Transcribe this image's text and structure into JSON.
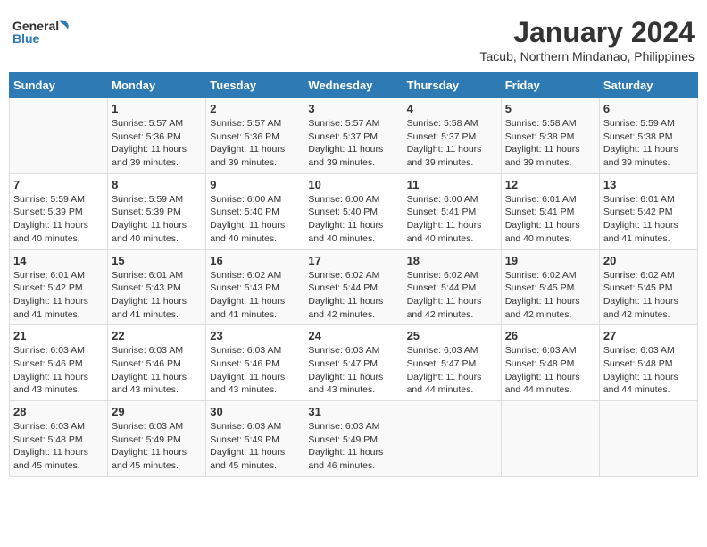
{
  "header": {
    "logo_line1": "General",
    "logo_line2": "Blue",
    "month_title": "January 2024",
    "location": "Tacub, Northern Mindanao, Philippines"
  },
  "days_of_week": [
    "Sunday",
    "Monday",
    "Tuesday",
    "Wednesday",
    "Thursday",
    "Friday",
    "Saturday"
  ],
  "weeks": [
    [
      {
        "day": "",
        "info": ""
      },
      {
        "day": "1",
        "info": "Sunrise: 5:57 AM\nSunset: 5:36 PM\nDaylight: 11 hours\nand 39 minutes."
      },
      {
        "day": "2",
        "info": "Sunrise: 5:57 AM\nSunset: 5:36 PM\nDaylight: 11 hours\nand 39 minutes."
      },
      {
        "day": "3",
        "info": "Sunrise: 5:57 AM\nSunset: 5:37 PM\nDaylight: 11 hours\nand 39 minutes."
      },
      {
        "day": "4",
        "info": "Sunrise: 5:58 AM\nSunset: 5:37 PM\nDaylight: 11 hours\nand 39 minutes."
      },
      {
        "day": "5",
        "info": "Sunrise: 5:58 AM\nSunset: 5:38 PM\nDaylight: 11 hours\nand 39 minutes."
      },
      {
        "day": "6",
        "info": "Sunrise: 5:59 AM\nSunset: 5:38 PM\nDaylight: 11 hours\nand 39 minutes."
      }
    ],
    [
      {
        "day": "7",
        "info": "Sunrise: 5:59 AM\nSunset: 5:39 PM\nDaylight: 11 hours\nand 40 minutes."
      },
      {
        "day": "8",
        "info": "Sunrise: 5:59 AM\nSunset: 5:39 PM\nDaylight: 11 hours\nand 40 minutes."
      },
      {
        "day": "9",
        "info": "Sunrise: 6:00 AM\nSunset: 5:40 PM\nDaylight: 11 hours\nand 40 minutes."
      },
      {
        "day": "10",
        "info": "Sunrise: 6:00 AM\nSunset: 5:40 PM\nDaylight: 11 hours\nand 40 minutes."
      },
      {
        "day": "11",
        "info": "Sunrise: 6:00 AM\nSunset: 5:41 PM\nDaylight: 11 hours\nand 40 minutes."
      },
      {
        "day": "12",
        "info": "Sunrise: 6:01 AM\nSunset: 5:41 PM\nDaylight: 11 hours\nand 40 minutes."
      },
      {
        "day": "13",
        "info": "Sunrise: 6:01 AM\nSunset: 5:42 PM\nDaylight: 11 hours\nand 41 minutes."
      }
    ],
    [
      {
        "day": "14",
        "info": "Sunrise: 6:01 AM\nSunset: 5:42 PM\nDaylight: 11 hours\nand 41 minutes."
      },
      {
        "day": "15",
        "info": "Sunrise: 6:01 AM\nSunset: 5:43 PM\nDaylight: 11 hours\nand 41 minutes."
      },
      {
        "day": "16",
        "info": "Sunrise: 6:02 AM\nSunset: 5:43 PM\nDaylight: 11 hours\nand 41 minutes."
      },
      {
        "day": "17",
        "info": "Sunrise: 6:02 AM\nSunset: 5:44 PM\nDaylight: 11 hours\nand 42 minutes."
      },
      {
        "day": "18",
        "info": "Sunrise: 6:02 AM\nSunset: 5:44 PM\nDaylight: 11 hours\nand 42 minutes."
      },
      {
        "day": "19",
        "info": "Sunrise: 6:02 AM\nSunset: 5:45 PM\nDaylight: 11 hours\nand 42 minutes."
      },
      {
        "day": "20",
        "info": "Sunrise: 6:02 AM\nSunset: 5:45 PM\nDaylight: 11 hours\nand 42 minutes."
      }
    ],
    [
      {
        "day": "21",
        "info": "Sunrise: 6:03 AM\nSunset: 5:46 PM\nDaylight: 11 hours\nand 43 minutes."
      },
      {
        "day": "22",
        "info": "Sunrise: 6:03 AM\nSunset: 5:46 PM\nDaylight: 11 hours\nand 43 minutes."
      },
      {
        "day": "23",
        "info": "Sunrise: 6:03 AM\nSunset: 5:46 PM\nDaylight: 11 hours\nand 43 minutes."
      },
      {
        "day": "24",
        "info": "Sunrise: 6:03 AM\nSunset: 5:47 PM\nDaylight: 11 hours\nand 43 minutes."
      },
      {
        "day": "25",
        "info": "Sunrise: 6:03 AM\nSunset: 5:47 PM\nDaylight: 11 hours\nand 44 minutes."
      },
      {
        "day": "26",
        "info": "Sunrise: 6:03 AM\nSunset: 5:48 PM\nDaylight: 11 hours\nand 44 minutes."
      },
      {
        "day": "27",
        "info": "Sunrise: 6:03 AM\nSunset: 5:48 PM\nDaylight: 11 hours\nand 44 minutes."
      }
    ],
    [
      {
        "day": "28",
        "info": "Sunrise: 6:03 AM\nSunset: 5:48 PM\nDaylight: 11 hours\nand 45 minutes."
      },
      {
        "day": "29",
        "info": "Sunrise: 6:03 AM\nSunset: 5:49 PM\nDaylight: 11 hours\nand 45 minutes."
      },
      {
        "day": "30",
        "info": "Sunrise: 6:03 AM\nSunset: 5:49 PM\nDaylight: 11 hours\nand 45 minutes."
      },
      {
        "day": "31",
        "info": "Sunrise: 6:03 AM\nSunset: 5:49 PM\nDaylight: 11 hours\nand 46 minutes."
      },
      {
        "day": "",
        "info": ""
      },
      {
        "day": "",
        "info": ""
      },
      {
        "day": "",
        "info": ""
      }
    ]
  ]
}
